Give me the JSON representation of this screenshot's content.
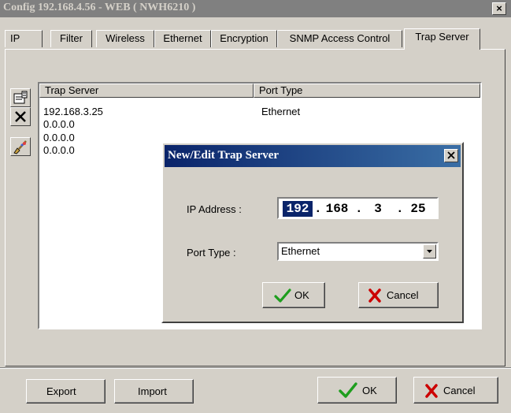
{
  "window": {
    "title": "Config 192.168.4.56 - WEB ( NWH6210 )",
    "close_glyph": "×"
  },
  "tabs": [
    {
      "label": "IP"
    },
    {
      "label": "Filter"
    },
    {
      "label": "Wireless"
    },
    {
      "label": "Ethernet"
    },
    {
      "label": "Encryption"
    },
    {
      "label": "SNMP Access Control"
    },
    {
      "label": "Trap Server",
      "active": true
    }
  ],
  "toolbar": {
    "items": [
      {
        "icon": "edit-properties-icon"
      },
      {
        "icon": "delete-x-icon"
      },
      {
        "icon": "clear-brush-icon"
      }
    ]
  },
  "list": {
    "columns": [
      "Trap Server",
      "Port Type"
    ],
    "rows": [
      {
        "server": "192.168.3.25",
        "port": "Ethernet"
      },
      {
        "server": "0.0.0.0",
        "port": ""
      },
      {
        "server": "0.0.0.0",
        "port": ""
      },
      {
        "server": "0.0.0.0",
        "port": ""
      }
    ]
  },
  "dialog": {
    "title": "New/Edit Trap Server",
    "ip_label": "IP Address :",
    "ip_octets": [
      "192",
      "168",
      "3",
      "25"
    ],
    "ip_selected_octet": 0,
    "ip_separator": ".",
    "port_label": "Port Type :",
    "port_value": "Ethernet",
    "ok_label": "OK",
    "cancel_label": "Cancel"
  },
  "footer": {
    "export_label": "Export",
    "import_label": "Import",
    "ok_label": "OK",
    "cancel_label": "Cancel"
  },
  "colors": {
    "face": "#d4d0c8",
    "title_active": "#0a246a",
    "title_inactive": "#808080",
    "check_green": "#1e9e1e",
    "cross_red": "#cc0000"
  }
}
